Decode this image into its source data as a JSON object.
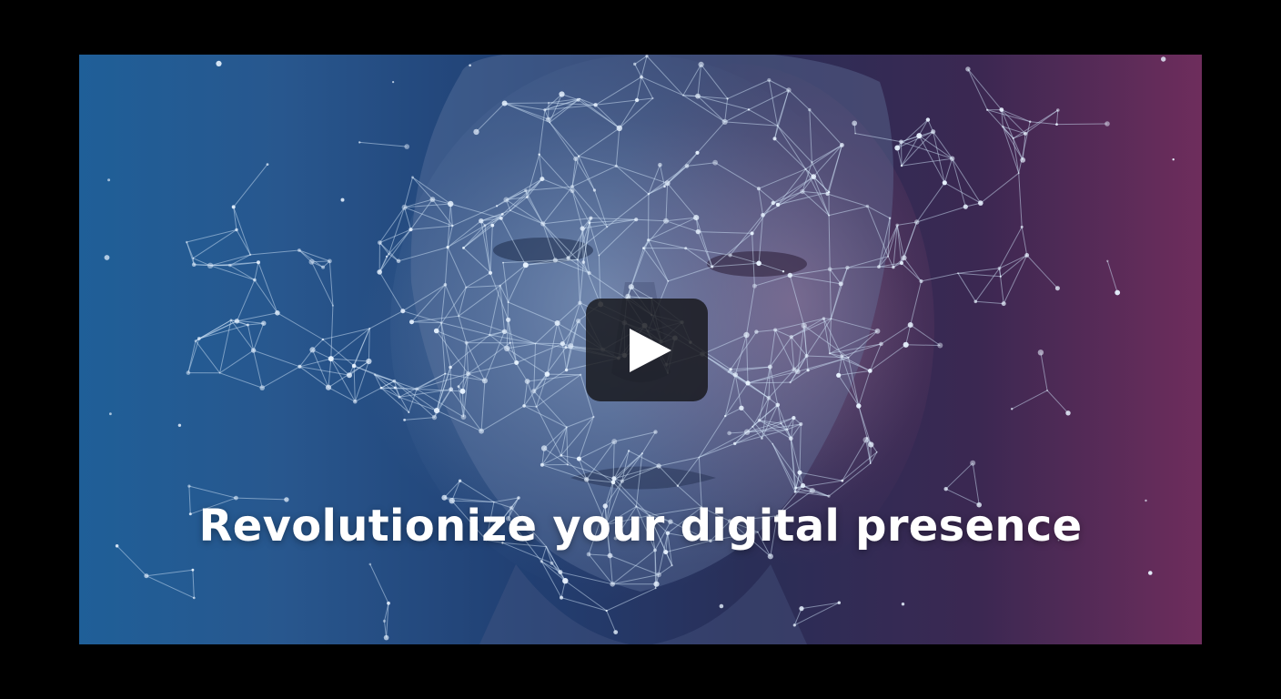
{
  "video": {
    "headline": "Revolutionize your digital presence",
    "play_icon": "play-icon",
    "colors": {
      "frame_background": "#000000",
      "gradient_left": "#1f5f98",
      "gradient_right": "#6e2d5c",
      "headline_text": "#ffffff",
      "play_button_bg": "#16161a",
      "play_icon": "#ffffff"
    }
  }
}
